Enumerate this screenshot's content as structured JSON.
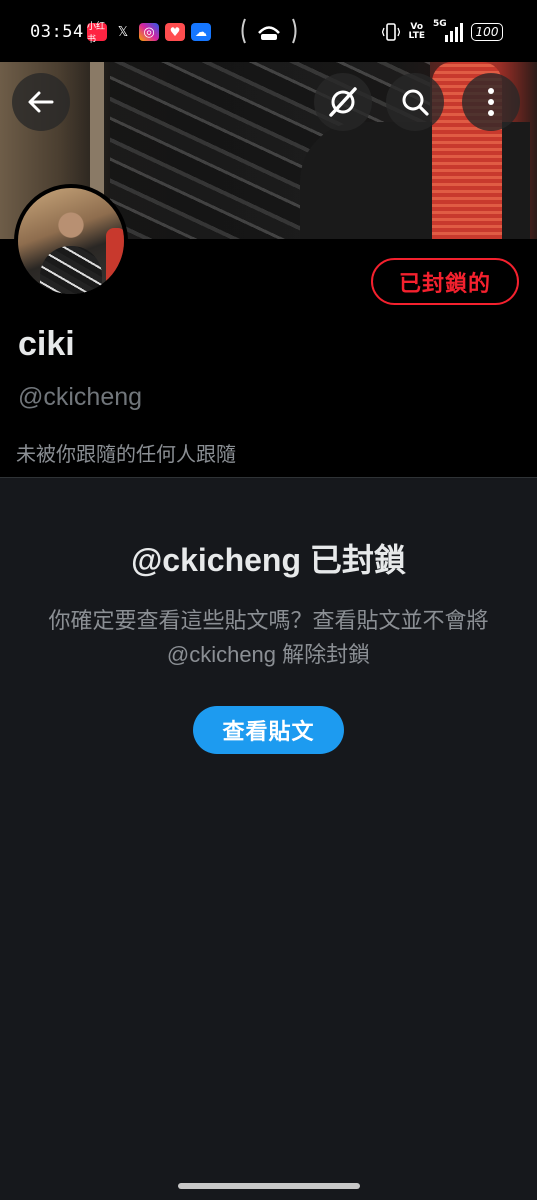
{
  "status_bar": {
    "time": "03:54",
    "apps": [
      {
        "icon": "xiaohongshu-icon",
        "label": "小红书",
        "color": "#ff2442"
      },
      {
        "icon": "x-icon",
        "label": "𝕏",
        "color": "#000000"
      },
      {
        "icon": "instagram-icon",
        "label": "◎",
        "color": "#d6249f"
      },
      {
        "icon": "heart-app-icon",
        "label": "♥",
        "color": "#ff4d4f"
      },
      {
        "icon": "cloud-app-icon",
        "label": "☁",
        "color": "#1677ff"
      }
    ],
    "volte_top": "Vo",
    "volte_bottom": "LTE",
    "network": "5G",
    "battery": "100"
  },
  "header": {
    "back_icon": "arrow-left-icon",
    "grok_icon": "grok-icon",
    "search_icon": "search-icon",
    "more_icon": "more-vertical-icon"
  },
  "profile": {
    "display_name": "ciki",
    "handle": "@ckicheng",
    "blocked_label": "已封鎖的",
    "follow_note": "未被你跟隨的任何人跟隨"
  },
  "blocked_notice": {
    "title": "@ckicheng 已封鎖",
    "description": "你確定要查看這些貼文嗎？查看貼文並不會將 @ckicheng 解除封鎖",
    "button_label": "查看貼文"
  },
  "colors": {
    "accent": "#1d9bf0",
    "blocked_red": "#f4212e",
    "panel_bg": "#16181c",
    "muted_text": "#71767b"
  }
}
